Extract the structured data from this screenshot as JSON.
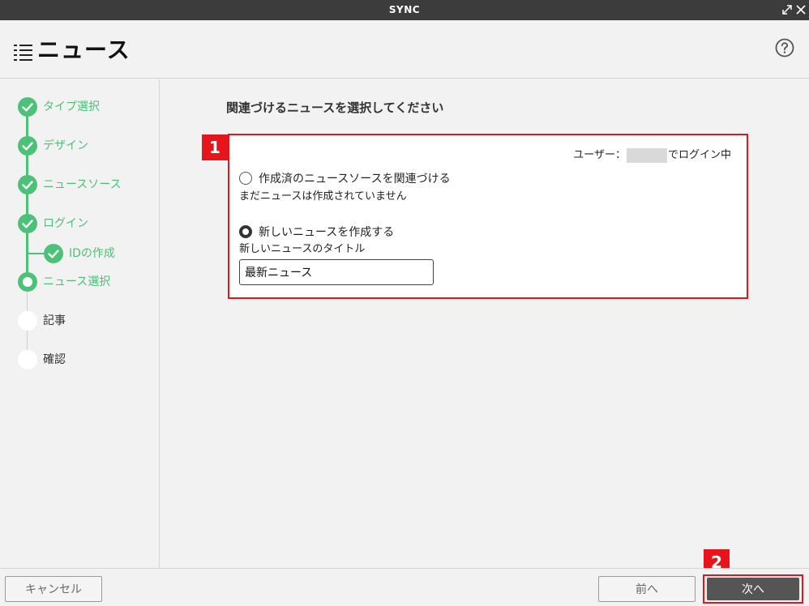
{
  "window": {
    "title": "SYNC"
  },
  "header": {
    "title": "ニュース"
  },
  "steps": [
    {
      "label": "タイプ選択",
      "state": "done"
    },
    {
      "label": "デザイン",
      "state": "done"
    },
    {
      "label": "ニュースソース",
      "state": "done"
    },
    {
      "label": "ログイン",
      "state": "done"
    },
    {
      "label": "IDの作成",
      "state": "done"
    },
    {
      "label": "ニュース選択",
      "state": "current"
    },
    {
      "label": "記事",
      "state": "todo"
    },
    {
      "label": "確認",
      "state": "todo"
    }
  ],
  "main": {
    "heading": "関連づけるニュースを選択してください",
    "login_prefix": "ユーザー：",
    "login_suffix": "でログイン中",
    "option_existing": "作成済のニュースソースを関連づける",
    "option_existing_note": "まだニュースは作成されていません",
    "option_new": "新しいニュースを作成する",
    "new_title_label": "新しいニュースのタイトル",
    "new_title_value": "最新ニュース",
    "selected_option": "new"
  },
  "annotations": {
    "badge_1": "1",
    "badge_2": "2"
  },
  "footer": {
    "cancel_label": "キャンセル",
    "prev_label": "前へ",
    "next_label": "次へ"
  },
  "colors": {
    "accent_green": "#4cc178",
    "highlight_red": "#e8141b",
    "titlebar": "#3c3c3c"
  }
}
